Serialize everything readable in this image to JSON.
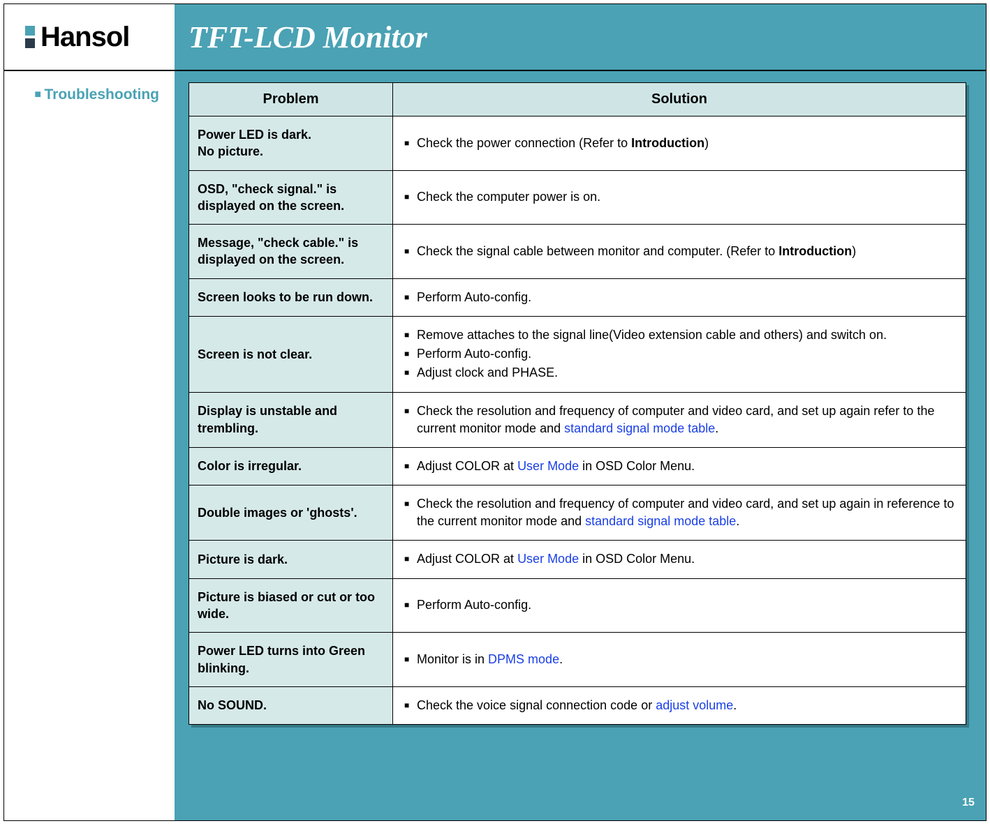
{
  "header": {
    "logo_text": "Hansol",
    "title": "TFT-LCD Monitor"
  },
  "sidebar": {
    "section_label": "Troubleshooting"
  },
  "table": {
    "headers": {
      "problem": "Problem",
      "solution": "Solution"
    },
    "rows": [
      {
        "problem": "Power LED is dark.\nNo picture.",
        "solutions": [
          {
            "parts": [
              {
                "t": "Check the power connection (Refer to "
              },
              {
                "t": "Introduction",
                "bold": true
              },
              {
                "t": ")"
              }
            ]
          }
        ]
      },
      {
        "problem": "OSD, \"check signal.\" is displayed on the screen.",
        "solutions": [
          {
            "parts": [
              {
                "t": "Check the computer power is on."
              }
            ]
          }
        ]
      },
      {
        "problem": "Message, \"check cable.\" is displayed on the screen.",
        "solutions": [
          {
            "parts": [
              {
                "t": "Check the signal cable between monitor and computer. (Refer to "
              },
              {
                "t": "Introduction",
                "bold": true
              },
              {
                "t": ")"
              }
            ]
          }
        ]
      },
      {
        "problem": "Screen looks to be run down.",
        "solutions": [
          {
            "parts": [
              {
                "t": "Perform Auto-config."
              }
            ]
          }
        ]
      },
      {
        "problem": "Screen is not clear.",
        "solutions": [
          {
            "parts": [
              {
                "t": "Remove attaches to the signal line(Video extension cable and others) and switch on."
              }
            ]
          },
          {
            "parts": [
              {
                "t": "Perform Auto-config."
              }
            ]
          },
          {
            "parts": [
              {
                "t": "Adjust clock and PHASE."
              }
            ]
          }
        ]
      },
      {
        "problem": "Display is unstable and trembling.",
        "solutions": [
          {
            "parts": [
              {
                "t": "Check the resolution and frequency of computer and video card, and set up again refer to the current monitor mode and "
              },
              {
                "t": "standard signal mode table",
                "link": true
              },
              {
                "t": "."
              }
            ]
          }
        ]
      },
      {
        "problem": "Color is irregular.",
        "solutions": [
          {
            "parts": [
              {
                "t": "Adjust COLOR at "
              },
              {
                "t": "User Mode",
                "link": true
              },
              {
                "t": " in OSD Color Menu."
              }
            ]
          }
        ]
      },
      {
        "problem": "Double images or 'ghosts'.",
        "solutions": [
          {
            "parts": [
              {
                "t": "Check the resolution and frequency of computer and video card, and set up again in reference to the current monitor mode and "
              },
              {
                "t": "standard signal mode table",
                "link": true
              },
              {
                "t": "."
              }
            ]
          }
        ]
      },
      {
        "problem": "Picture is dark.",
        "solutions": [
          {
            "parts": [
              {
                "t": "Adjust COLOR at "
              },
              {
                "t": "User Mode",
                "link": true
              },
              {
                "t": " in OSD Color Menu."
              }
            ]
          }
        ]
      },
      {
        "problem": "Picture is biased or cut or too wide.",
        "solutions": [
          {
            "parts": [
              {
                "t": "Perform Auto-config."
              }
            ]
          }
        ]
      },
      {
        "problem": "Power LED turns into Green blinking.",
        "solutions": [
          {
            "parts": [
              {
                "t": "Monitor is in "
              },
              {
                "t": "DPMS mode",
                "link": true
              },
              {
                "t": "."
              }
            ]
          }
        ]
      },
      {
        "problem": "No SOUND.",
        "solutions": [
          {
            "parts": [
              {
                "t": "Check the voice signal connection code or "
              },
              {
                "t": "adjust volume",
                "link": true
              },
              {
                "t": "."
              }
            ]
          }
        ]
      }
    ]
  },
  "page_number": "15"
}
